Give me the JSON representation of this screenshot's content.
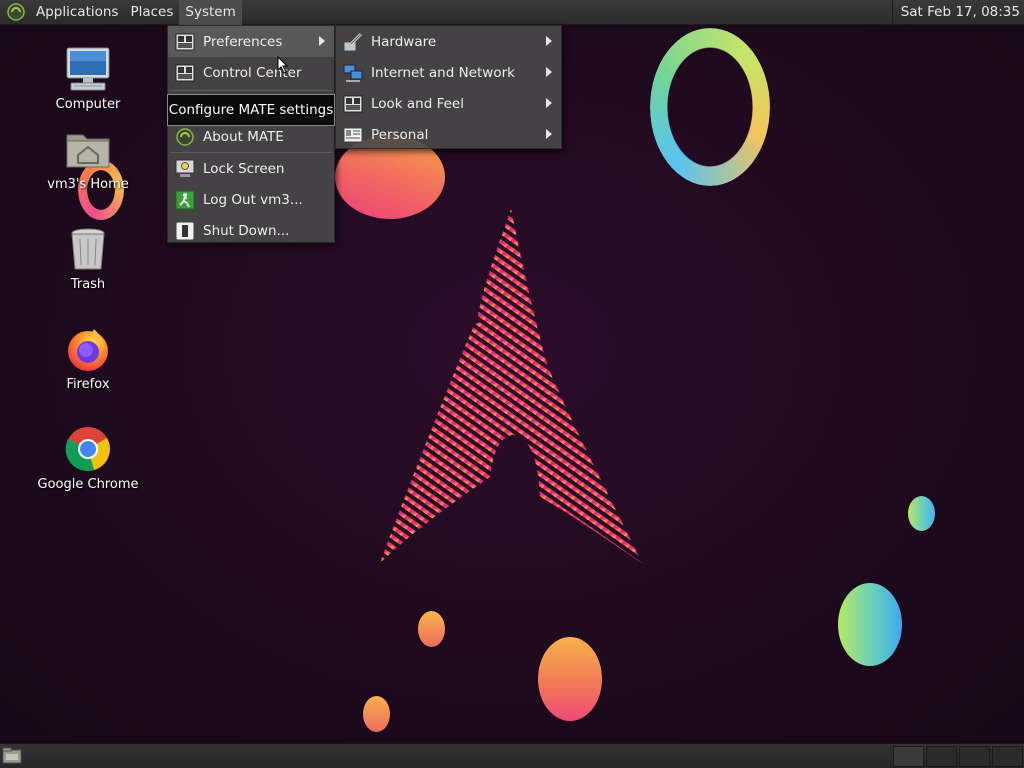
{
  "top_panel": {
    "menus": [
      {
        "label": "Applications"
      },
      {
        "label": "Places"
      },
      {
        "label": "System"
      }
    ],
    "clock": "Sat Feb 17, 08:35"
  },
  "desktop_icons": [
    {
      "label": "Computer",
      "icon": "computer-icon"
    },
    {
      "label": "vm3's Home",
      "icon": "home-folder-icon"
    },
    {
      "label": "Trash",
      "icon": "trash-icon"
    },
    {
      "label": "Firefox",
      "icon": "firefox-icon"
    },
    {
      "label": "Google Chrome",
      "icon": "chrome-icon"
    }
  ],
  "system_menu": {
    "items": [
      {
        "label": "Preferences",
        "icon": "preferences-icon",
        "has_submenu": true
      },
      {
        "label": "Control Center",
        "icon": "control-center-icon"
      },
      {
        "label": "About MATE",
        "icon": "mate-logo-icon"
      },
      {
        "label": "Lock Screen",
        "icon": "lock-screen-icon"
      },
      {
        "label": "Log Out vm3...",
        "icon": "log-out-icon"
      },
      {
        "label": "Shut Down...",
        "icon": "shut-down-icon"
      }
    ]
  },
  "preferences_submenu": {
    "items": [
      {
        "label": "Hardware",
        "icon": "hardware-icon"
      },
      {
        "label": "Internet and Network",
        "icon": "network-icon"
      },
      {
        "label": "Look and Feel",
        "icon": "look-and-feel-icon"
      },
      {
        "label": "Personal",
        "icon": "personal-icon"
      }
    ]
  },
  "tooltip": "Configure MATE settings",
  "colors": {
    "panel": "#2f2f2f",
    "menu_bg": "#484848",
    "highlight": "#6e6e6e",
    "wallpaper": "#22091f",
    "arch_pink": "#e8267a",
    "arch_yellow": "#f4d03f"
  }
}
